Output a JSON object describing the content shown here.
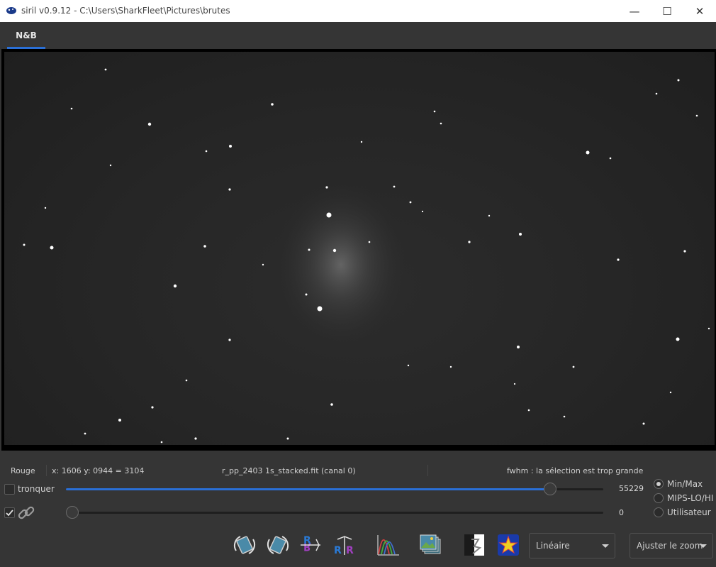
{
  "window": {
    "title": "siril v0.9.12 - C:\\Users\\SharkFleet\\Pictures\\brutes",
    "minimize": "—",
    "maximize": "☐",
    "close": "✕"
  },
  "tabs": [
    {
      "label": "N&B",
      "active": true
    }
  ],
  "status": {
    "channel": "Rouge",
    "coords": "x: 1606 y: 0944 = 3104",
    "filename": "r_pp_2403 1s_stacked.fit (canal 0)",
    "fwhm": "fwhm : la sélection est trop grande"
  },
  "controls": {
    "tronquer_label": "tronquer",
    "tronquer_checked": false,
    "link_checked": true,
    "high_value": "55229",
    "low_value": "0",
    "high_fraction": 0.9,
    "low_fraction": 0.0
  },
  "scale_modes": [
    {
      "label": "Min/Max",
      "selected": true
    },
    {
      "label": "MIPS-LO/HI",
      "selected": false
    },
    {
      "label": "Utilisateur",
      "selected": false
    }
  ],
  "toolbar": {
    "icons": [
      "rotate-left-icon",
      "rotate-right-icon",
      "mirror-x-icon",
      "mirror-y-icon",
      "histogram-icon",
      "image-stack-icon",
      "negative-icon",
      "color-star-icon"
    ],
    "scale_dropdown": "Linéaire",
    "zoom_dropdown": "Ajuster le zoom"
  },
  "colors": {
    "accent": "#2a6fd6",
    "background": "#353535",
    "titlebar": "#ffffff"
  }
}
